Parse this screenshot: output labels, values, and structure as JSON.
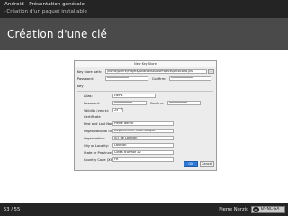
{
  "header": {
    "section": "Android - Présentation générale",
    "subsection": "Création d'un paquet installable",
    "tree_glyph": "└"
  },
  "frame": {
    "title": "Création d'une clé"
  },
  "dialog": {
    "title": "New Key Store",
    "keystore_path_label": "Key store path:",
    "keystore_path_value": "/home/pierre/Projets/AndroidStudioProjects/Ensicaea.jks",
    "browse_label": "...",
    "password_label": "Password:",
    "password_value": "••••••••••••",
    "confirm_label": "Confirm:",
    "confirm_value": "••••••••••••",
    "key_section": "Key",
    "alias_label": "Alias:",
    "alias_value": "clePN",
    "key_password_label": "Password:",
    "key_password_value": "••••••••••",
    "key_confirm_label": "Confirm:",
    "key_confirm_value": "••••••••••",
    "validity_label": "Validity (years):",
    "validity_value": "25",
    "spin_glyph": "⇕",
    "certificate_label": "Certificate",
    "first_last_label": "First and Last Name:",
    "first_last_value": "Pierre Nerzic",
    "org_unit_label": "Organizational Unit:",
    "org_unit_value": "Département Informatique",
    "org_label": "Organization:",
    "org_value": "IUT de Lannion",
    "city_label": "City or Locality:",
    "city_value": "Lannion",
    "state_label": "State or Province:",
    "state_value": "Côtes d'Armor 22",
    "country_label": "Country Code (XX):",
    "country_value": "FR",
    "ok_label": "OK",
    "cancel_label": "Cancel"
  },
  "footer": {
    "page": "53 / 55",
    "author": "Pierre Nerzic",
    "license_logo": "cc",
    "license_text": "BY-NC-SA"
  }
}
